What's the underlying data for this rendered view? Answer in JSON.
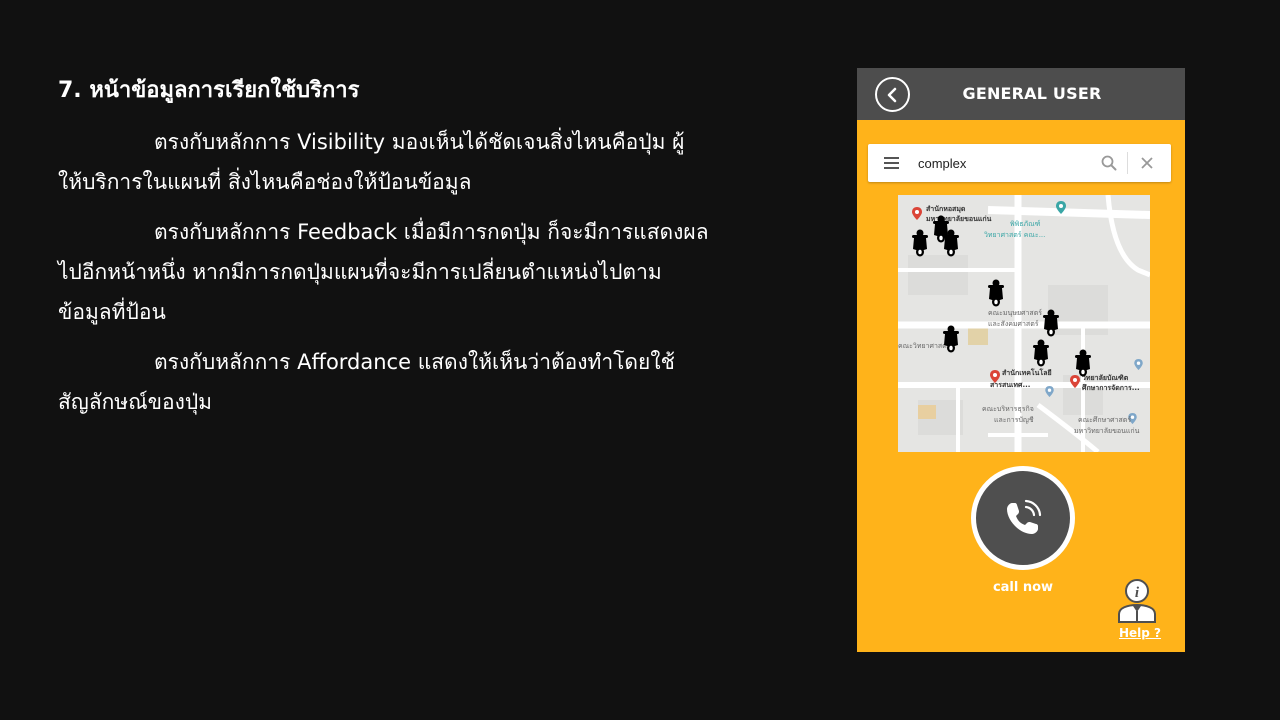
{
  "slide": {
    "title": "7. หน้าข้อมูลการเรียกใช้บริการ",
    "paragraphs": [
      {
        "lines": [
          "ตรงกับหลักการ Visibility มองเห็นได้ชัดเจนสิ่งไหนคือปุ่ม ผู้",
          "ให้บริการในแผนที่ สิ่งไหนคือช่องให้ป้อนข้อมูล"
        ]
      },
      {
        "lines": [
          "ตรงกับหลักการ Feedback เมื่อมีการกดปุ่ม ก็จะมีการแสดงผล",
          "ไปอีกหน้าหนึ่ง หากมีการกดปุ่มแผนที่จะมีการเปลี่ยนตำแหน่งไปตาม",
          "ข้อมูลที่ป้อน"
        ]
      },
      {
        "lines": [
          "ตรงกับหลักการ Affordance แสดงให้เห็นว่าต้องทำโดยใช้",
          "สัญลักษณ์ของปุ่ม"
        ]
      }
    ]
  },
  "app": {
    "header_title": "GENERAL USER",
    "search": {
      "value": "complex"
    },
    "map": {
      "labels": [
        {
          "text": "สำนักหอสมุด",
          "style": "dark"
        },
        {
          "text": "มหาวิทยาลัยขอนแก่น",
          "style": "dark"
        },
        {
          "text": "พิพิธภัณฑ์",
          "style": "teal"
        },
        {
          "text": "วิทยาศาสตร์ คณะ...",
          "style": "teal"
        },
        {
          "text": "คณะมนุษยศาสตร์",
          "style": "normal"
        },
        {
          "text": "และสังคมศาสตร์",
          "style": "normal"
        },
        {
          "text": "คณะวิทยาศาสตร์",
          "style": "normal"
        },
        {
          "text": "สำนักเทคโนโลยี",
          "style": "dark"
        },
        {
          "text": "สารสนเทศ...",
          "style": "dark"
        },
        {
          "text": "วิทยาลัยบัณฑิต",
          "style": "dark"
        },
        {
          "text": "ศึกษาการจัดการ...",
          "style": "dark"
        },
        {
          "text": "คณะบริหารธุรกิจ",
          "style": "normal"
        },
        {
          "text": "และการบัญชี",
          "style": "normal"
        },
        {
          "text": "คณะศึกษาศาสตร์",
          "style": "normal"
        },
        {
          "text": "มหาวิทยาลัยขอนแก่น",
          "style": "normal"
        }
      ],
      "scooter_count": 9
    },
    "call_label": "call now",
    "help_label": "Help ?"
  },
  "colors": {
    "background": "#111111",
    "app_accent": "#FFB31A",
    "header_bar": "#4D4D4D",
    "call_button": "#4F4F4F"
  }
}
